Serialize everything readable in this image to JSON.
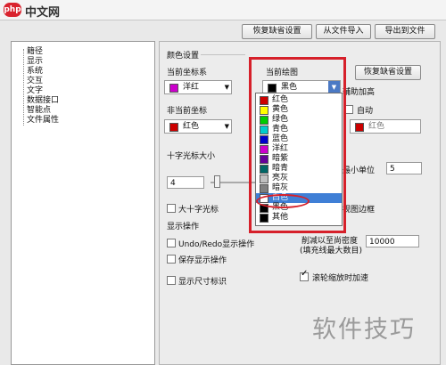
{
  "brand": {
    "logo_text": "php",
    "site_name": "中文网"
  },
  "toolbar": {
    "restore_defaults": "恢复缺省设置",
    "import_file": "从文件导入",
    "export_file": "导出到文件"
  },
  "tree": {
    "items": [
      "籍径",
      "显示",
      "系统",
      "交互",
      "文字",
      "数据接口",
      "智能点",
      "文件属性"
    ]
  },
  "colors": {
    "section_title": "颜色设置",
    "current_coord_label": "当前坐标系",
    "current_coord_value": "洋红",
    "noncurrent_coord_label": "非当前坐标",
    "noncurrent_coord_value": "红色",
    "current_draw_label": "当前绘图",
    "current_draw_value": "黑色",
    "restore_button": "恢复缺省设置",
    "assist_label": "辅助加高",
    "auto_label": "自动",
    "assist_color_value": "红色"
  },
  "cursor": {
    "size_label": "十字光标大小",
    "size_value": "4",
    "min_unit_label": "最小单位",
    "min_unit_value": "5",
    "big_cross_label": "大十字光标",
    "view_border_label": "视图边框"
  },
  "display": {
    "section_title": "显示操作",
    "undo_redo_label": "Undo/Redo显示操作",
    "save_label": "保存显示操作",
    "dim_label": "显示尺寸标识",
    "limit_label_1": "削减以至尚密度",
    "limit_label_2": "(填充线最大数目)",
    "limit_value": "10000",
    "wheel_label": "滚轮缩放时加速"
  },
  "dropdown": {
    "items": [
      {
        "label": "红色",
        "color": "#cc0000"
      },
      {
        "label": "黄色",
        "color": "#ffff00"
      },
      {
        "label": "绿色",
        "color": "#00cc00"
      },
      {
        "label": "青色",
        "color": "#00cccc"
      },
      {
        "label": "蓝色",
        "color": "#0000cc"
      },
      {
        "label": "洋红",
        "color": "#cc00cc"
      },
      {
        "label": "暗紫",
        "color": "#660099"
      },
      {
        "label": "暗青",
        "color": "#006666"
      },
      {
        "label": "亮灰",
        "color": "#c0c0c0"
      },
      {
        "label": "暗灰",
        "color": "#808080"
      },
      {
        "label": "白色",
        "color": "#ffffff"
      },
      {
        "label": "黑色",
        "color": "#000000"
      },
      {
        "label": "其他",
        "color": "#000000"
      }
    ],
    "selected_index": 10
  },
  "watermark": {
    "text": "软件技巧"
  },
  "palette": {
    "magenta": "#cc00cc",
    "red": "#cc0000",
    "black": "#000000",
    "annotation_red": "#d6202a"
  }
}
